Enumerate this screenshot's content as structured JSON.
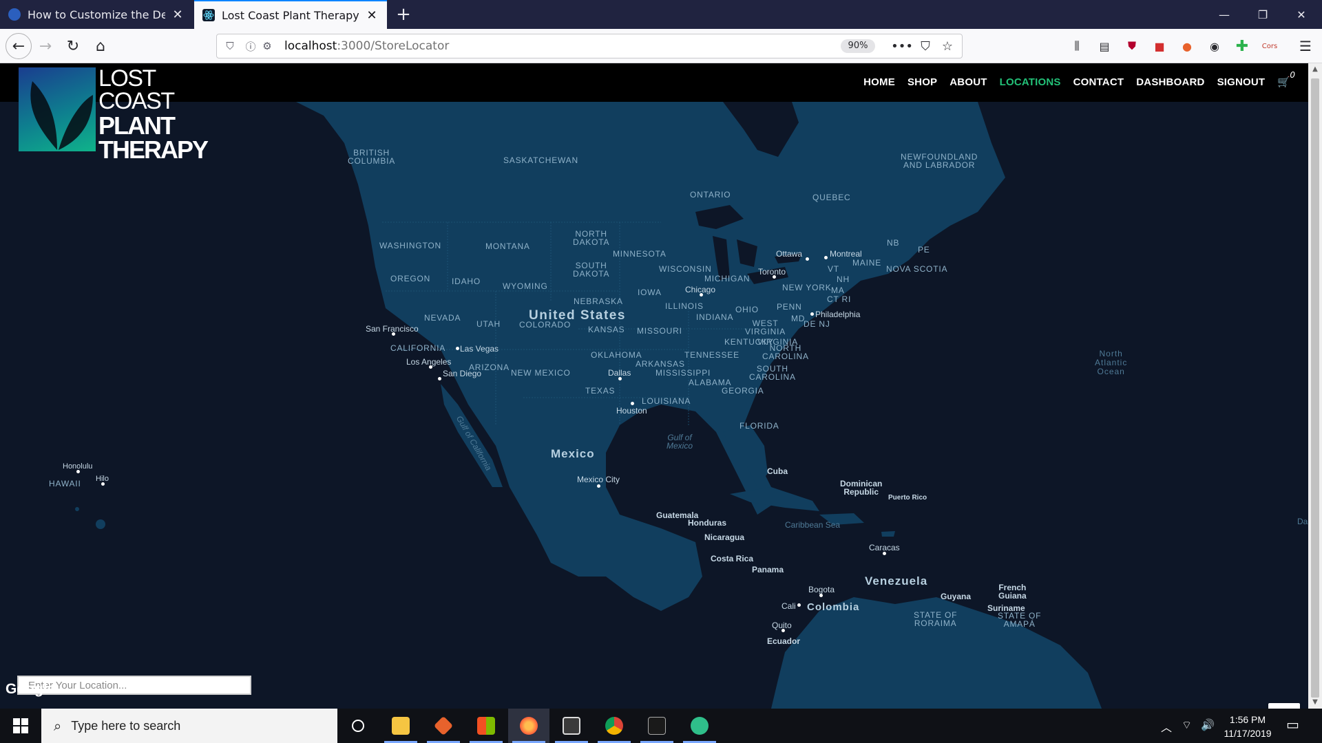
{
  "browser": {
    "tabs": [
      {
        "title": "How to Customize the Default"
      },
      {
        "title": "Lost Coast Plant Therapy"
      }
    ],
    "url_host": "localhost",
    "url_path": ":3000/StoreLocator",
    "zoom": "90%"
  },
  "site": {
    "logo": {
      "line1": "LOST",
      "line2": "COAST",
      "line3": "PLANT",
      "line4": "THERAPY"
    },
    "nav": [
      "HOME",
      "SHOP",
      "ABOUT",
      "LOCATIONS",
      "CONTACT",
      "DASHBOARD",
      "SIGNOUT"
    ],
    "active_nav": "LOCATIONS",
    "cart_count": "0",
    "accent_color": "#23c178"
  },
  "map": {
    "location_placeholder": "Enter Your Location...",
    "attribution": "Google",
    "regions": {
      "british_columbia": "BRITISH\nCOLUMBIA",
      "saskatchewan": "SASKATCHEWAN",
      "ontario": "ONTARIO",
      "quebec": "QUEBEC",
      "newfoundland": "NEWFOUNDLAND\nAND LABRADOR",
      "washington": "WASHINGTON",
      "montana": "MONTANA",
      "north_dakota": "NORTH\nDAKOTA",
      "minnesota": "MINNESOTA",
      "oregon": "OREGON",
      "idaho": "IDAHO",
      "wyoming": "WYOMING",
      "south_dakota": "SOUTH\nDAKOTA",
      "wisconsin": "WISCONSIN",
      "michigan": "MICHIGAN",
      "nevada": "NEVADA",
      "utah": "UTAH",
      "colorado": "COLORADO",
      "nebraska": "NEBRASKA",
      "iowa": "IOWA",
      "illinois": "ILLINOIS",
      "indiana": "INDIANA",
      "ohio": "OHIO",
      "penn": "PENN",
      "new_york": "NEW YORK",
      "vt": "VT",
      "nh": "NH",
      "ma": "MA",
      "ct_ri": "CT RI",
      "maine": "MAINE",
      "nb": "NB",
      "pe": "PE",
      "nova_scotia": "NOVA SCOTIA",
      "md": "MD",
      "de_nj": "DE NJ",
      "california": "CALIFORNIA",
      "arizona": "ARIZONA",
      "new_mexico": "NEW MEXICO",
      "kansas": "KANSAS",
      "missouri": "MISSOURI",
      "kentucky": "KENTUCKY",
      "west_virginia": "WEST\nVIRGINIA",
      "virginia": "VIRGINIA",
      "oklahoma": "OKLAHOMA",
      "arkansas": "ARKANSAS",
      "tennessee": "TENNESSEE",
      "north_carolina": "NORTH\nCAROLINA",
      "south_carolina": "SOUTH\nCAROLINA",
      "mississippi": "MISSISSIPPI",
      "alabama": "ALABAMA",
      "georgia": "GEORGIA",
      "texas": "TEXAS",
      "louisiana": "LOUISIANA",
      "florida": "FLORIDA",
      "hawaii": "HAWAII",
      "state_of_roraima": "STATE OF\nRORAIMA",
      "state_of_amapa": "STATE OF\nAMAPÁ"
    },
    "countries": {
      "united_states": "United States",
      "mexico": "Mexico",
      "venezuela": "Venezuela",
      "colombia": "Colombia",
      "cuba": "Cuba",
      "dominican_republic": "Dominican\nRepublic",
      "guatemala": "Guatemala",
      "honduras": "Honduras",
      "nicaragua": "Nicaragua",
      "costa_rica": "Costa Rica",
      "panama": "Panama",
      "guyana": "Guyana",
      "suriname": "Suriname",
      "french_guiana": "French\nGuiana",
      "ecuador": "Ecuador",
      "puerto_rico": "Puerto Rico"
    },
    "cities": {
      "ottawa": "Ottawa",
      "montreal": "Montreal",
      "toronto": "Toronto",
      "chicago": "Chicago",
      "philadelphia": "Philadelphia",
      "san_francisco": "San Francisco",
      "las_vegas": "Las Vegas",
      "los_angeles": "Los Angeles",
      "san_diego": "San Diego",
      "dallas": "Dallas",
      "houston": "Houston",
      "mexico_city": "Mexico City",
      "honolulu": "Honolulu",
      "hilo": "Hilo",
      "caracas": "Caracas",
      "bogota": "Bogota",
      "cali": "Cali",
      "quito": "Quito"
    },
    "water": {
      "gulf_of_mexico": "Gulf of\nMexico",
      "gulf_of_california": "Gulf of California",
      "caribbean_sea": "Caribbean Sea",
      "north_atlantic": "North\nAtlantic\nOcean",
      "edge": "Da"
    }
  },
  "taskbar": {
    "search_placeholder": "Type here to search",
    "time": "1:56 PM",
    "date": "11/17/2019"
  }
}
